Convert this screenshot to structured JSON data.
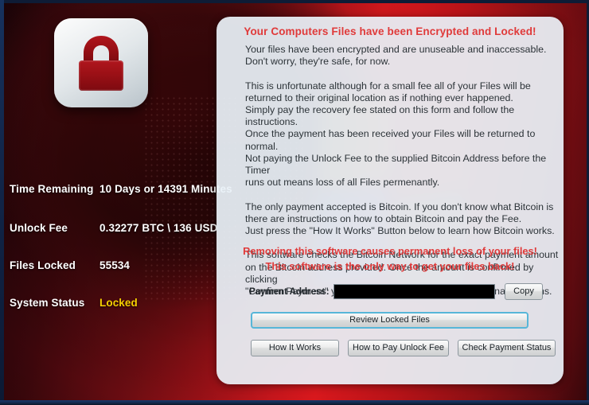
{
  "window": {
    "title": "Your Computers Files have been Encrypted and Locked!"
  },
  "colors": {
    "alert_red": "#e03a3a",
    "status_warning": "#f5d000",
    "panel_background": "#eaf1f8",
    "backdrop_red": "#c5161c",
    "lock_body": "#9e1117"
  },
  "lock_icon": {
    "name": "padlock-icon",
    "label": "Padlock"
  },
  "stats": [
    {
      "label": "Time Remaining",
      "value": "10 Days or 14391 Minutes",
      "warning": false
    },
    {
      "label": "Unlock Fee",
      "value": "0.32277 BTC \\ 136 USD",
      "warning": false
    },
    {
      "label": "Files Locked",
      "value": "55534",
      "warning": false
    },
    {
      "label": "System Status",
      "value": "Locked",
      "warning": true
    }
  ],
  "panel": {
    "title": "Your Computers Files have been Encrypted and Locked!",
    "body": "Your files have been encrypted and are unuseable and inaccessable.\nDon't worry, they're safe, for now.\n\nThis is unfortunate although for a small fee all of your Files will be\nreturned to their original location as if nothing ever happened.\nSimply pay the recovery fee stated on this form and follow the instructions.\nOnce the payment has been received your Files will be returned to normal.\nNot paying the Unlock Fee to the supplied Bitcoin Address before the Timer\nruns out means loss of all Files permenantly.\n\nThe only payment accepted is Bitcoin. If you don't know what Bitcoin is\nthere are instructions on how to obtain Bitcoin and pay the Fee.\nJust press the \"How It Works\" Button below to learn how Bitcoin works.\n\nThis software checks the Bitcoin Network for the exact payment amount\non the Bitcoin address provided. Once the amount is confirmed by clicking\n\"Confirm Payment\" your files will be returned to their original locations.",
    "warning_line_1": "Removing this software causes permanent loss of your files!",
    "warning_line_2": "This software is the only way to get your files back!"
  },
  "payment": {
    "address_label": "Payment Address:",
    "address_value": "",
    "address_placeholder": "",
    "copy_label": "Copy"
  },
  "buttons": {
    "review_locked_files": "Review Locked Files",
    "how_it_works": "How It Works",
    "how_to_pay": "How to Pay Unlock Fee",
    "check_payment_status": "Check Payment Status"
  }
}
